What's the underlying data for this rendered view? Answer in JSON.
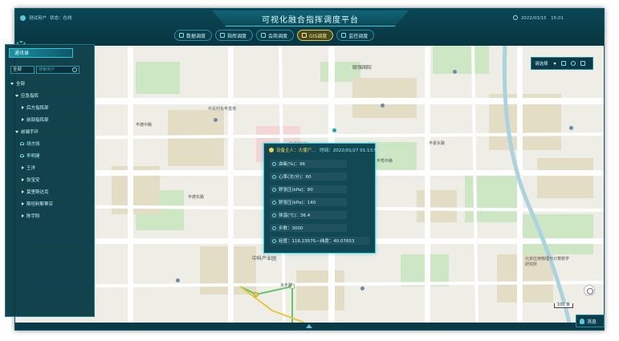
{
  "app": {
    "title": "可视化融合指挥调度平台",
    "user": "测试用户",
    "status_label": "状态：在线",
    "datetime": "2022/03/15　15:01"
  },
  "nav": {
    "tabs": [
      {
        "label": "数据调度",
        "active": false
      },
      {
        "label": "指挥调度",
        "active": false
      },
      {
        "label": "会商调度",
        "active": false
      },
      {
        "label": "GIS调度",
        "active": true
      },
      {
        "label": "监控调度",
        "active": false
      }
    ]
  },
  "sidebar": {
    "tab_label": "通讯录",
    "dept_select": "全部",
    "search_placeholder": "搜索用户",
    "tree": [
      {
        "label": "全部",
        "level": 0,
        "state": "expanded"
      },
      {
        "label": "应急指挥",
        "level": 1,
        "state": "expanded"
      },
      {
        "label": "后方指挥部",
        "level": 2,
        "state": "collapsed"
      },
      {
        "label": "前部指挥部",
        "level": 2,
        "state": "collapsed"
      },
      {
        "label": "前端手环",
        "level": 1,
        "state": "expanded"
      },
      {
        "label": "胡杰强",
        "level": 2,
        "state": "member"
      },
      {
        "label": "李明建",
        "level": 2,
        "state": "member"
      },
      {
        "label": "王洋",
        "level": 2,
        "state": "collapsed"
      },
      {
        "label": "张宝安",
        "level": 2,
        "state": "collapsed"
      },
      {
        "label": "莫里斯达克",
        "level": 2,
        "state": "collapsed"
      },
      {
        "label": "斯坦利斯蒂芬",
        "level": 2,
        "state": "collapsed"
      },
      {
        "label": "陈宇阳",
        "level": 2,
        "state": "collapsed"
      }
    ]
  },
  "map_toolbar": {
    "select_label": "请选择"
  },
  "popup": {
    "device": "设备主人：大僵尸...",
    "time": "时间：2022/01/27 01:13:54",
    "rows": [
      {
        "label": "血氧(%)：96"
      },
      {
        "label": "心率(次/分)：60"
      },
      {
        "label": "舒张压(kPa)：80"
      },
      {
        "label": "舒张压(kPa)：140"
      },
      {
        "label": "体温(℃)：36.4"
      },
      {
        "label": "步数：3000"
      },
      {
        "label": "经度：116.23575—纬度：40.07653"
      }
    ]
  },
  "map_labels": {
    "l1": "永丰科技",
    "l2": "联强国际",
    "l3": "中科产业园",
    "l4": "北京应用物理与计算数学研究所",
    "l5": "丰豪东路",
    "l6": "丰德中路",
    "l7": "丰德东路",
    "l8": "中关村永丰基地",
    "l9": "丰秀中路",
    "l10": "永丰路"
  },
  "scale_label": "100 米",
  "message_button": "消息",
  "colors": {
    "frame": "#0a3a47",
    "accent": "#39d2e1",
    "active_tab": "#d9c95a",
    "popup_name": "#f3d855",
    "map_bg": "#eeede6",
    "road": "#ffffff",
    "green": "#cde7c5",
    "building": "#e2ddc4"
  },
  "icons": {
    "gear": "gear-icon",
    "search": "search-icon",
    "warn": "warn-icon",
    "user": "user-icon",
    "clock": "clock-icon"
  }
}
